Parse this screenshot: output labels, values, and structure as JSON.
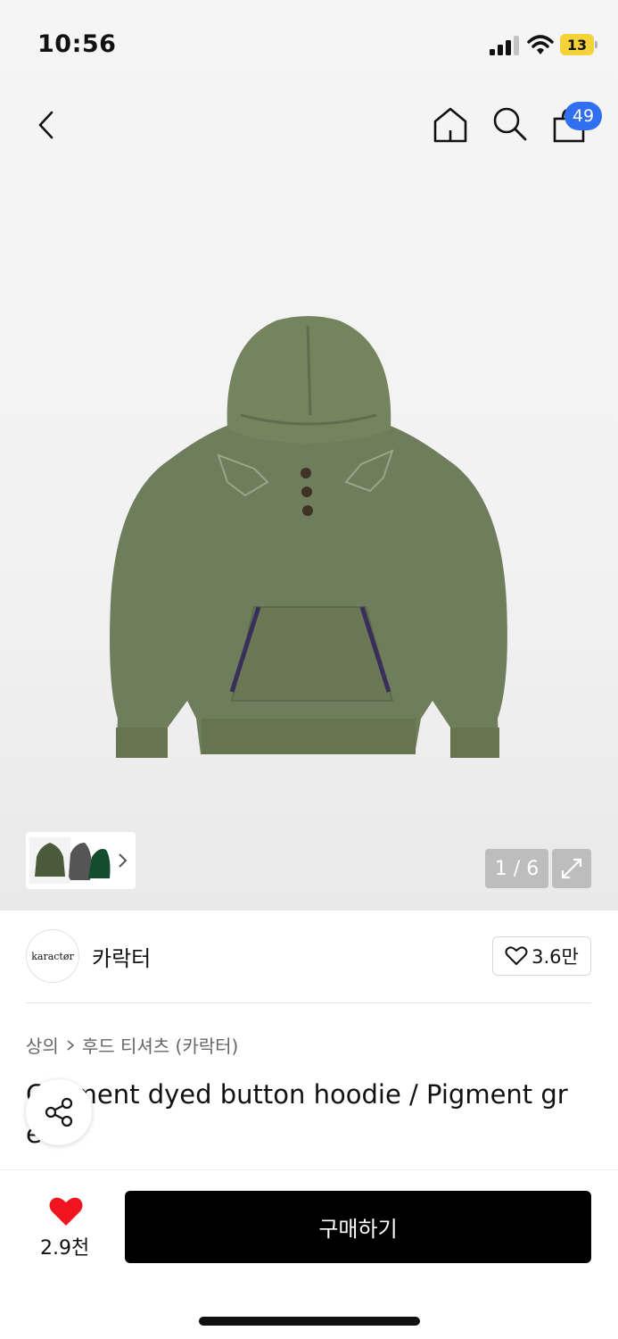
{
  "status_bar": {
    "time": "10:56",
    "battery": "13"
  },
  "nav": {
    "cart_count": "49",
    "icons": [
      "back-icon",
      "home-icon",
      "search-icon",
      "shopping-bag-icon"
    ]
  },
  "gallery": {
    "page_counter": "1 / 6"
  },
  "brand": {
    "logo_text": "karactør",
    "name": "카락터",
    "like_count": "3.6만"
  },
  "breadcrumb": {
    "category": "상의",
    "subcategory": "후드 티셔츠 (카락터)"
  },
  "product": {
    "title": "Garment dyed button hoodie / Pigment gr een"
  },
  "bottom_bar": {
    "like_count": "2.9천",
    "buy_label": "구매하기"
  },
  "colors": {
    "accent": "#2f6ff0",
    "heart": "#f0141e",
    "buy_bg": "#000000"
  }
}
